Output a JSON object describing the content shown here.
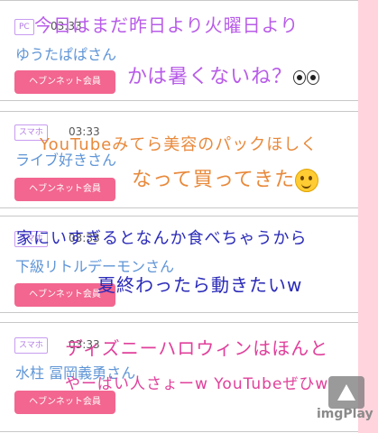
{
  "posts": [
    {
      "badge": "PC",
      "time": "03:33",
      "name": "ゆうたぱぱさん",
      "button": "ヘブンネット会員"
    },
    {
      "badge": "スマホ",
      "time": "03:33",
      "name": "ライブ好きさん",
      "button": "ヘブンネット会員"
    },
    {
      "badge": "スマホ",
      "time": "03:33",
      "name": "下級リトルデーモンさん",
      "button": "ヘブンネット会員"
    },
    {
      "badge": "スマホ",
      "time": "03:33",
      "name": "水柱 冨岡義勇さん",
      "button": "ヘブンネット会員"
    }
  ],
  "overlays": [
    "今日はまだ昨日より火曜日より",
    "かは暑くないね？",
    "YouTubeみてら美容のパックほしく",
    "なって買ってきた",
    "家にいすぎるとなんか食べちゃうから",
    "夏終わったら動きたいw",
    "ディズニーハロウィンはほんと",
    "やーばい人さょーw YouTubeぜひw"
  ],
  "icons": {
    "eyes": "eyes-emoji-icon",
    "smile": "smiling-face-emoji-icon",
    "camera": "camera-icon"
  },
  "watermark": "imgPlay",
  "colors": {
    "accent": "#f2668f",
    "name": "#5f95d6",
    "band": "#ffd4dd"
  }
}
